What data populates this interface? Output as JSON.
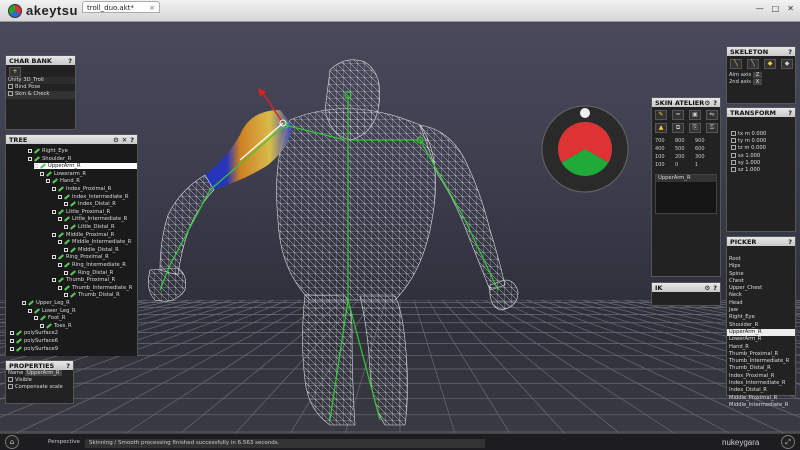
{
  "app": {
    "logo_text": "akeytsu",
    "tab_title": "troll_duo.akt*",
    "tab_close": "×"
  },
  "window_controls": [
    "—",
    "□",
    "✕"
  ],
  "char_bank": {
    "title": "CHAR BANK",
    "items": [
      {
        "label": "Unity 3D_Troll"
      },
      {
        "label": "Bind Pose"
      },
      {
        "label": "Skin & Check"
      }
    ]
  },
  "tree": {
    "title": "TREE",
    "items": [
      {
        "label": "Right_Eye",
        "depth": 3
      },
      {
        "label": "Shoulder_R",
        "depth": 3
      },
      {
        "label": "UpperArm_R",
        "depth": 4,
        "selected": true
      },
      {
        "label": "Lowerarm_R",
        "depth": 5
      },
      {
        "label": "Hand_R",
        "depth": 6
      },
      {
        "label": "Index_Proximal_R",
        "depth": 7
      },
      {
        "label": "Index_Intermediate_R",
        "depth": 8
      },
      {
        "label": "Index_Distal_R",
        "depth": 9
      },
      {
        "label": "Little_Proximal_R",
        "depth": 7
      },
      {
        "label": "Little_Intermediate_R",
        "depth": 8
      },
      {
        "label": "Little_Distal_R",
        "depth": 9
      },
      {
        "label": "Middle_Proximal_R",
        "depth": 7
      },
      {
        "label": "Middle_Intermediate_R",
        "depth": 8
      },
      {
        "label": "Middle_Distal_R",
        "depth": 9
      },
      {
        "label": "Ring_Proximal_R",
        "depth": 7
      },
      {
        "label": "Ring_Intermediate_R",
        "depth": 8
      },
      {
        "label": "Ring_Distal_R",
        "depth": 9
      },
      {
        "label": "Thumb_Proximal_R",
        "depth": 7
      },
      {
        "label": "Thumb_Intermediate_R",
        "depth": 8
      },
      {
        "label": "Thumb_Distal_R",
        "depth": 9
      },
      {
        "label": "Upper_Leg_R",
        "depth": 2
      },
      {
        "label": "Lower_Leg_R",
        "depth": 3
      },
      {
        "label": "Foot_R",
        "depth": 4
      },
      {
        "label": "Toes_R",
        "depth": 5
      },
      {
        "label": "polySurface2",
        "depth": 0
      },
      {
        "label": "polySurface6",
        "depth": 0
      },
      {
        "label": "polySurface9",
        "depth": 0
      }
    ]
  },
  "properties": {
    "title": "PROPERTIES",
    "name_label": "Name",
    "name_value": "UpperArm_R",
    "visible": "Visible",
    "compensate": "Compensate scale"
  },
  "skeleton": {
    "title": "SKELETON",
    "aim_axis_label": "Aim axis",
    "aim_axis_value": "Z",
    "twist_axis_label": "2nd axis",
    "twist_axis_value": "X"
  },
  "skin_atelier": {
    "title": "SKIN ATELIER",
    "values": [
      "100",
      "700",
      "800",
      "900",
      "400",
      "500",
      "600",
      "100",
      "200",
      "300",
      "0",
      "1"
    ],
    "list_item": "UpperArm_R"
  },
  "transform": {
    "title": "TRANSFORM",
    "values": [
      "m 0.000",
      "m 0.000",
      "m 0.000",
      "1.000",
      "1.000",
      "1.000"
    ]
  },
  "ik": {
    "title": "IK"
  },
  "picker": {
    "title": "PICKER",
    "items": [
      "Root",
      "Hips",
      "Spine",
      "Chest",
      "Upper_Chest",
      "Neck",
      "Head",
      "Jaw",
      "Right_Eye",
      "Shoulder_R",
      "UpperArm_R",
      "LowerArm_R",
      "Hand_R",
      "Thumb_Proximal_R",
      "Thumb_Intermediate_R",
      "Thumb_Distal_R",
      "Index_Proximal_R",
      "Index_Intermediate_R",
      "Index_Distal_R",
      "Middle_Proximal_R",
      "Middle_Intermediate_R"
    ],
    "selected": "UpperArm_R"
  },
  "status": {
    "view": "Perspective",
    "message": "Skinning / Smooth processing finished successfully in 6.563 seconds.",
    "brand": "nukeygara"
  },
  "colors": {
    "accent_red": "#d33",
    "accent_blue": "#2a6fd6",
    "accent_green": "#1faa3a",
    "bone_green": "#3c3"
  }
}
